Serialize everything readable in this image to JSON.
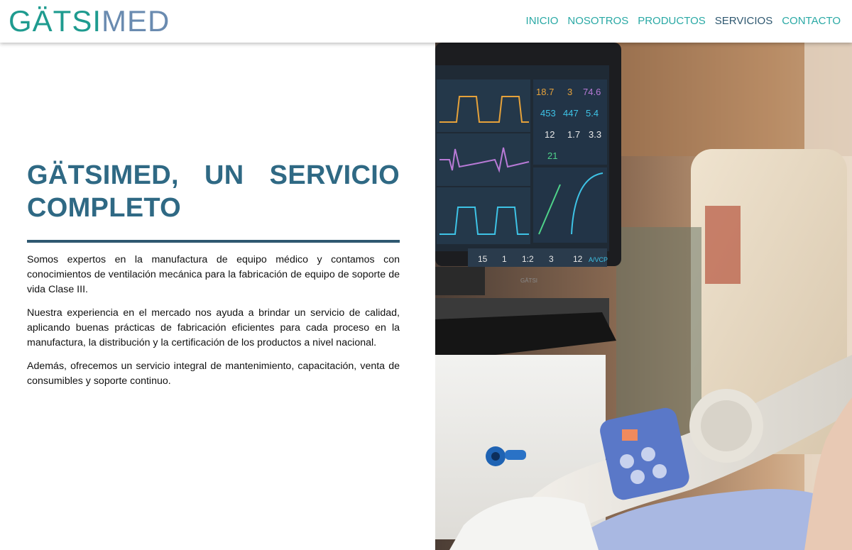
{
  "brand": {
    "logo_part1": "GÄTSI",
    "logo_part2": "MED"
  },
  "nav": {
    "items": [
      {
        "label": "INICIO",
        "active": false
      },
      {
        "label": "NOSOTROS",
        "active": false
      },
      {
        "label": "PRODUCTOS",
        "active": false
      },
      {
        "label": "SERVICIOS",
        "active": true
      },
      {
        "label": "CONTACTO",
        "active": false
      }
    ]
  },
  "main": {
    "title": "GÄTSIMED, UN SERVICIO COMPLETO",
    "paragraphs": [
      "Somos expertos en la manufactura de equipo médico y contamos con conocimientos de ventilación mecánica para la fabricación de equipo de soporte de vida Clase III.",
      "Nuestra experiencia en el mercado nos ayuda a brindar un servicio de calidad, aplicando buenas prácticas de fabricación eficientes para cada proceso en la manufactura, la distribución y la certificación de los productos a nivel nacional.",
      "Además, ofrecemos un servicio integral de mantenimiento, capacitación, venta de consumibles y soporte continuo."
    ]
  },
  "monitor": {
    "values": [
      "18.7",
      "3",
      "74.6",
      "453",
      "447",
      "5.4",
      "12",
      "1.7",
      "3.3",
      "21"
    ],
    "bottom": [
      "15",
      "1",
      "1:2",
      "3",
      "12",
      "A/VCP"
    ],
    "device_label": "GÄTSI"
  },
  "colors": {
    "accent": "#2f6984",
    "rule": "#2f5870",
    "nav": "#2aa9a5",
    "nav_active": "#2f5870",
    "logo_primary": "#1e9b8f",
    "logo_secondary": "#6a8bb0"
  }
}
